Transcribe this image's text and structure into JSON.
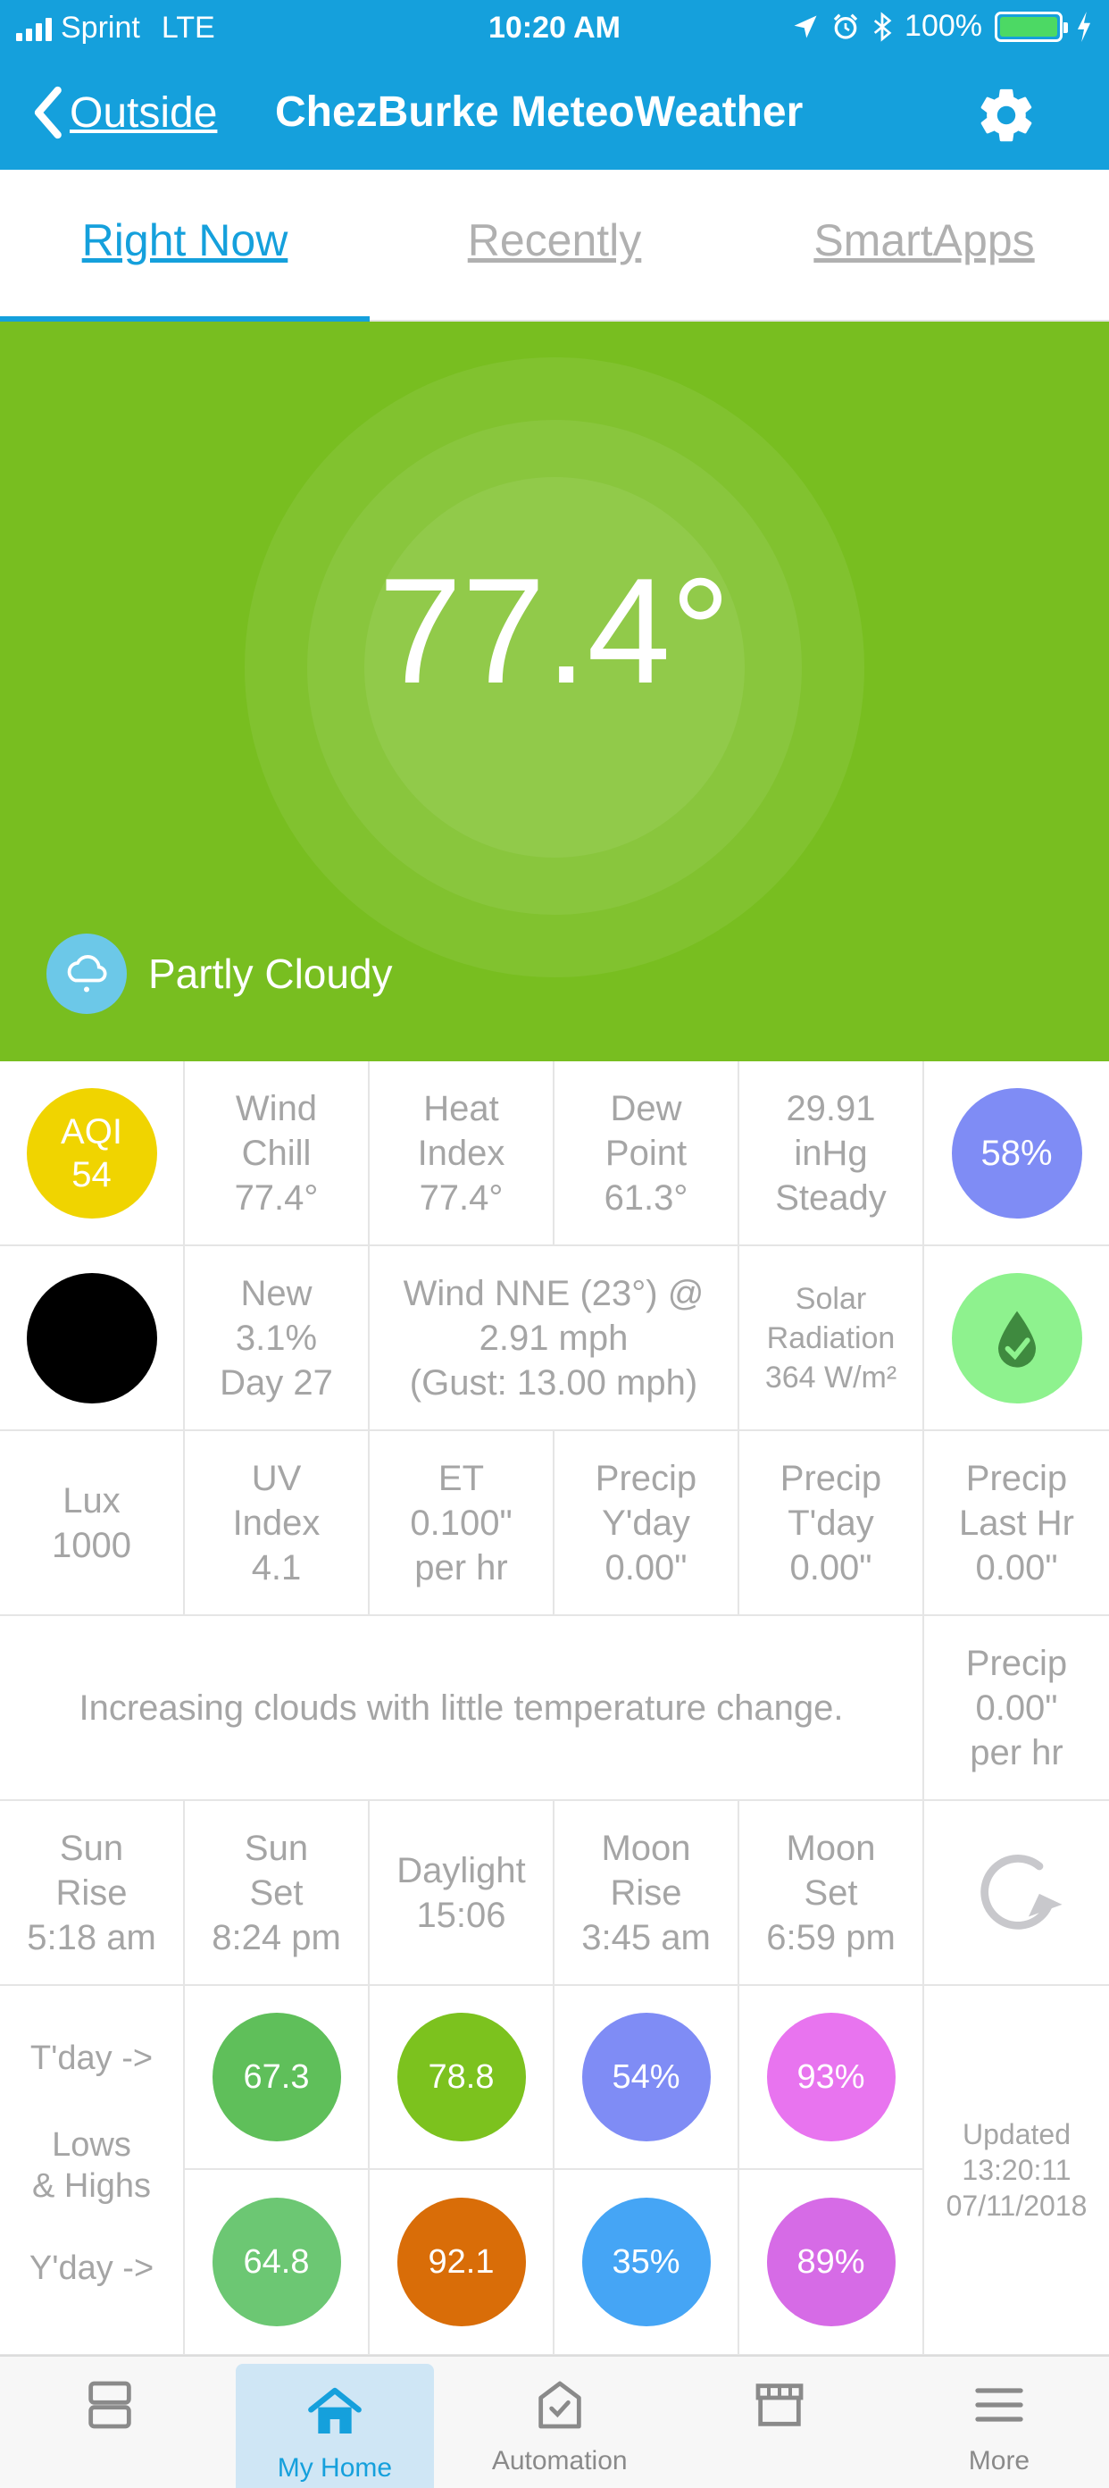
{
  "status_bar": {
    "carrier": "Sprint",
    "network": "LTE",
    "time": "10:20 AM",
    "battery": "100%"
  },
  "header": {
    "back_label": "Outside",
    "title": "ChezBurke MeteoWeather",
    "icons": [
      "back-chevron-icon",
      "gear-icon"
    ]
  },
  "tabs": [
    {
      "label": "Right Now",
      "active": true
    },
    {
      "label": "Recently",
      "active": false
    },
    {
      "label": "SmartApps",
      "active": false
    }
  ],
  "hero": {
    "temperature": "77.4°",
    "condition": "Partly Cloudy",
    "background_color": "#78be20"
  },
  "row1": {
    "aqi": "AQI\n54",
    "wind_chill": "Wind\nChill\n77.4°",
    "heat_index": "Heat\nIndex\n77.4°",
    "dew_point": "Dew\nPoint\n61.3°",
    "pressure": "29.91\ninHg\nSteady",
    "humidity": "58%"
  },
  "row2": {
    "moon_phase": "New\n3.1%\nDay 27",
    "wind": "Wind NNE (23°) @\n2.91 mph\n(Gust: 13.00 mph)",
    "solar": "Solar\nRadiation\n364 W/m²"
  },
  "row3": {
    "lux": "Lux\n1000",
    "uv": "UV\nIndex\n4.1",
    "et": "ET\n0.100\"\nper hr",
    "precip_yday": "Precip\nY'day\n0.00\"",
    "precip_tday": "Precip\nT'day\n0.00\"",
    "precip_last_hr": "Precip\nLast Hr\n0.00\""
  },
  "row4": {
    "forecast": "Increasing clouds with little temperature change.",
    "precip_rate": "Precip\n0.00\"\nper hr"
  },
  "row5": {
    "sunrise": "Sun\nRise\n5:18 am",
    "sunset": "Sun\nSet\n8:24 pm",
    "daylight": "Daylight\n15:06",
    "moonrise": "Moon\nRise\n3:45 am",
    "moonset": "Moon\nSet\n6:59 pm"
  },
  "lows_highs": {
    "today_label": "T'day ->",
    "center_label": "Lows\n& Highs",
    "yday_label": "Y'day ->",
    "today": [
      {
        "value": "67.3",
        "color": "#5fbf5a"
      },
      {
        "value": "78.8",
        "color": "#7cc21e"
      },
      {
        "value": "54%",
        "color": "#7f8cf5"
      },
      {
        "value": "93%",
        "color": "#e874ef"
      }
    ],
    "yesterday": [
      {
        "value": "64.8",
        "color": "#6cc773"
      },
      {
        "value": "92.1",
        "color": "#d96d08"
      },
      {
        "value": "35%",
        "color": "#45a5f5"
      },
      {
        "value": "89%",
        "color": "#d66be6"
      }
    ],
    "updated": "Updated\n13:20:11\n07/11/2018"
  },
  "circle_colors": {
    "aqi": "#f0d400",
    "humidity": "#7f8cf5",
    "moon": "#000000",
    "water_ok": "#8ef28e"
  },
  "bottom_nav": [
    {
      "label": "",
      "icon": "dashboard-icon",
      "active": false
    },
    {
      "label": "My Home",
      "icon": "home-icon",
      "active": true
    },
    {
      "label": "Automation",
      "icon": "automation-icon",
      "active": false
    },
    {
      "label": "",
      "icon": "marketplace-icon",
      "active": false
    },
    {
      "label": "More",
      "icon": "menu-icon",
      "active": false
    }
  ]
}
